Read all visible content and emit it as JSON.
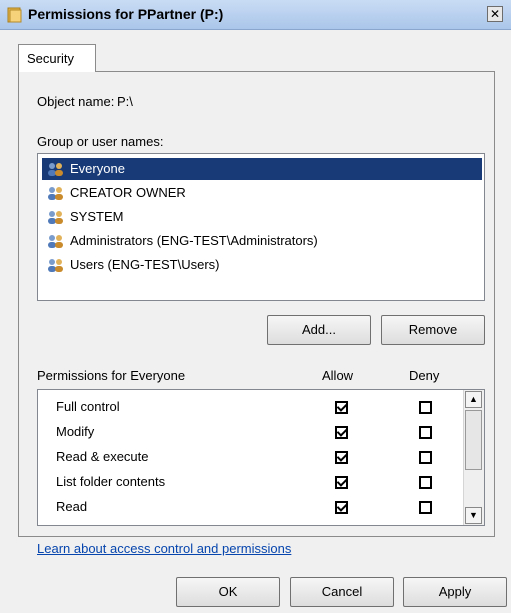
{
  "window": {
    "title": "Permissions for PPartner (P:)",
    "close_glyph": "✕"
  },
  "tabs": [
    {
      "label": "Security"
    }
  ],
  "object": {
    "label": "Object name:",
    "value": "P:\\"
  },
  "group_label": "Group or user names:",
  "users": [
    {
      "name": "Everyone",
      "selected": true
    },
    {
      "name": "CREATOR OWNER",
      "selected": false
    },
    {
      "name": "SYSTEM",
      "selected": false
    },
    {
      "name": "Administrators (ENG-TEST\\Administrators)",
      "selected": false
    },
    {
      "name": "Users (ENG-TEST\\Users)",
      "selected": false
    }
  ],
  "buttons": {
    "add": "Add...",
    "remove": "Remove",
    "ok": "OK",
    "cancel": "Cancel",
    "apply": "Apply"
  },
  "permissions": {
    "header": "Permissions for Everyone",
    "allow_label": "Allow",
    "deny_label": "Deny",
    "rows": [
      {
        "name": "Full control",
        "allow": true,
        "deny": false
      },
      {
        "name": "Modify",
        "allow": true,
        "deny": false
      },
      {
        "name": "Read & execute",
        "allow": true,
        "deny": false
      },
      {
        "name": "List folder contents",
        "allow": true,
        "deny": false
      },
      {
        "name": "Read",
        "allow": true,
        "deny": false
      }
    ]
  },
  "help_link": "Learn about access control and permissions"
}
